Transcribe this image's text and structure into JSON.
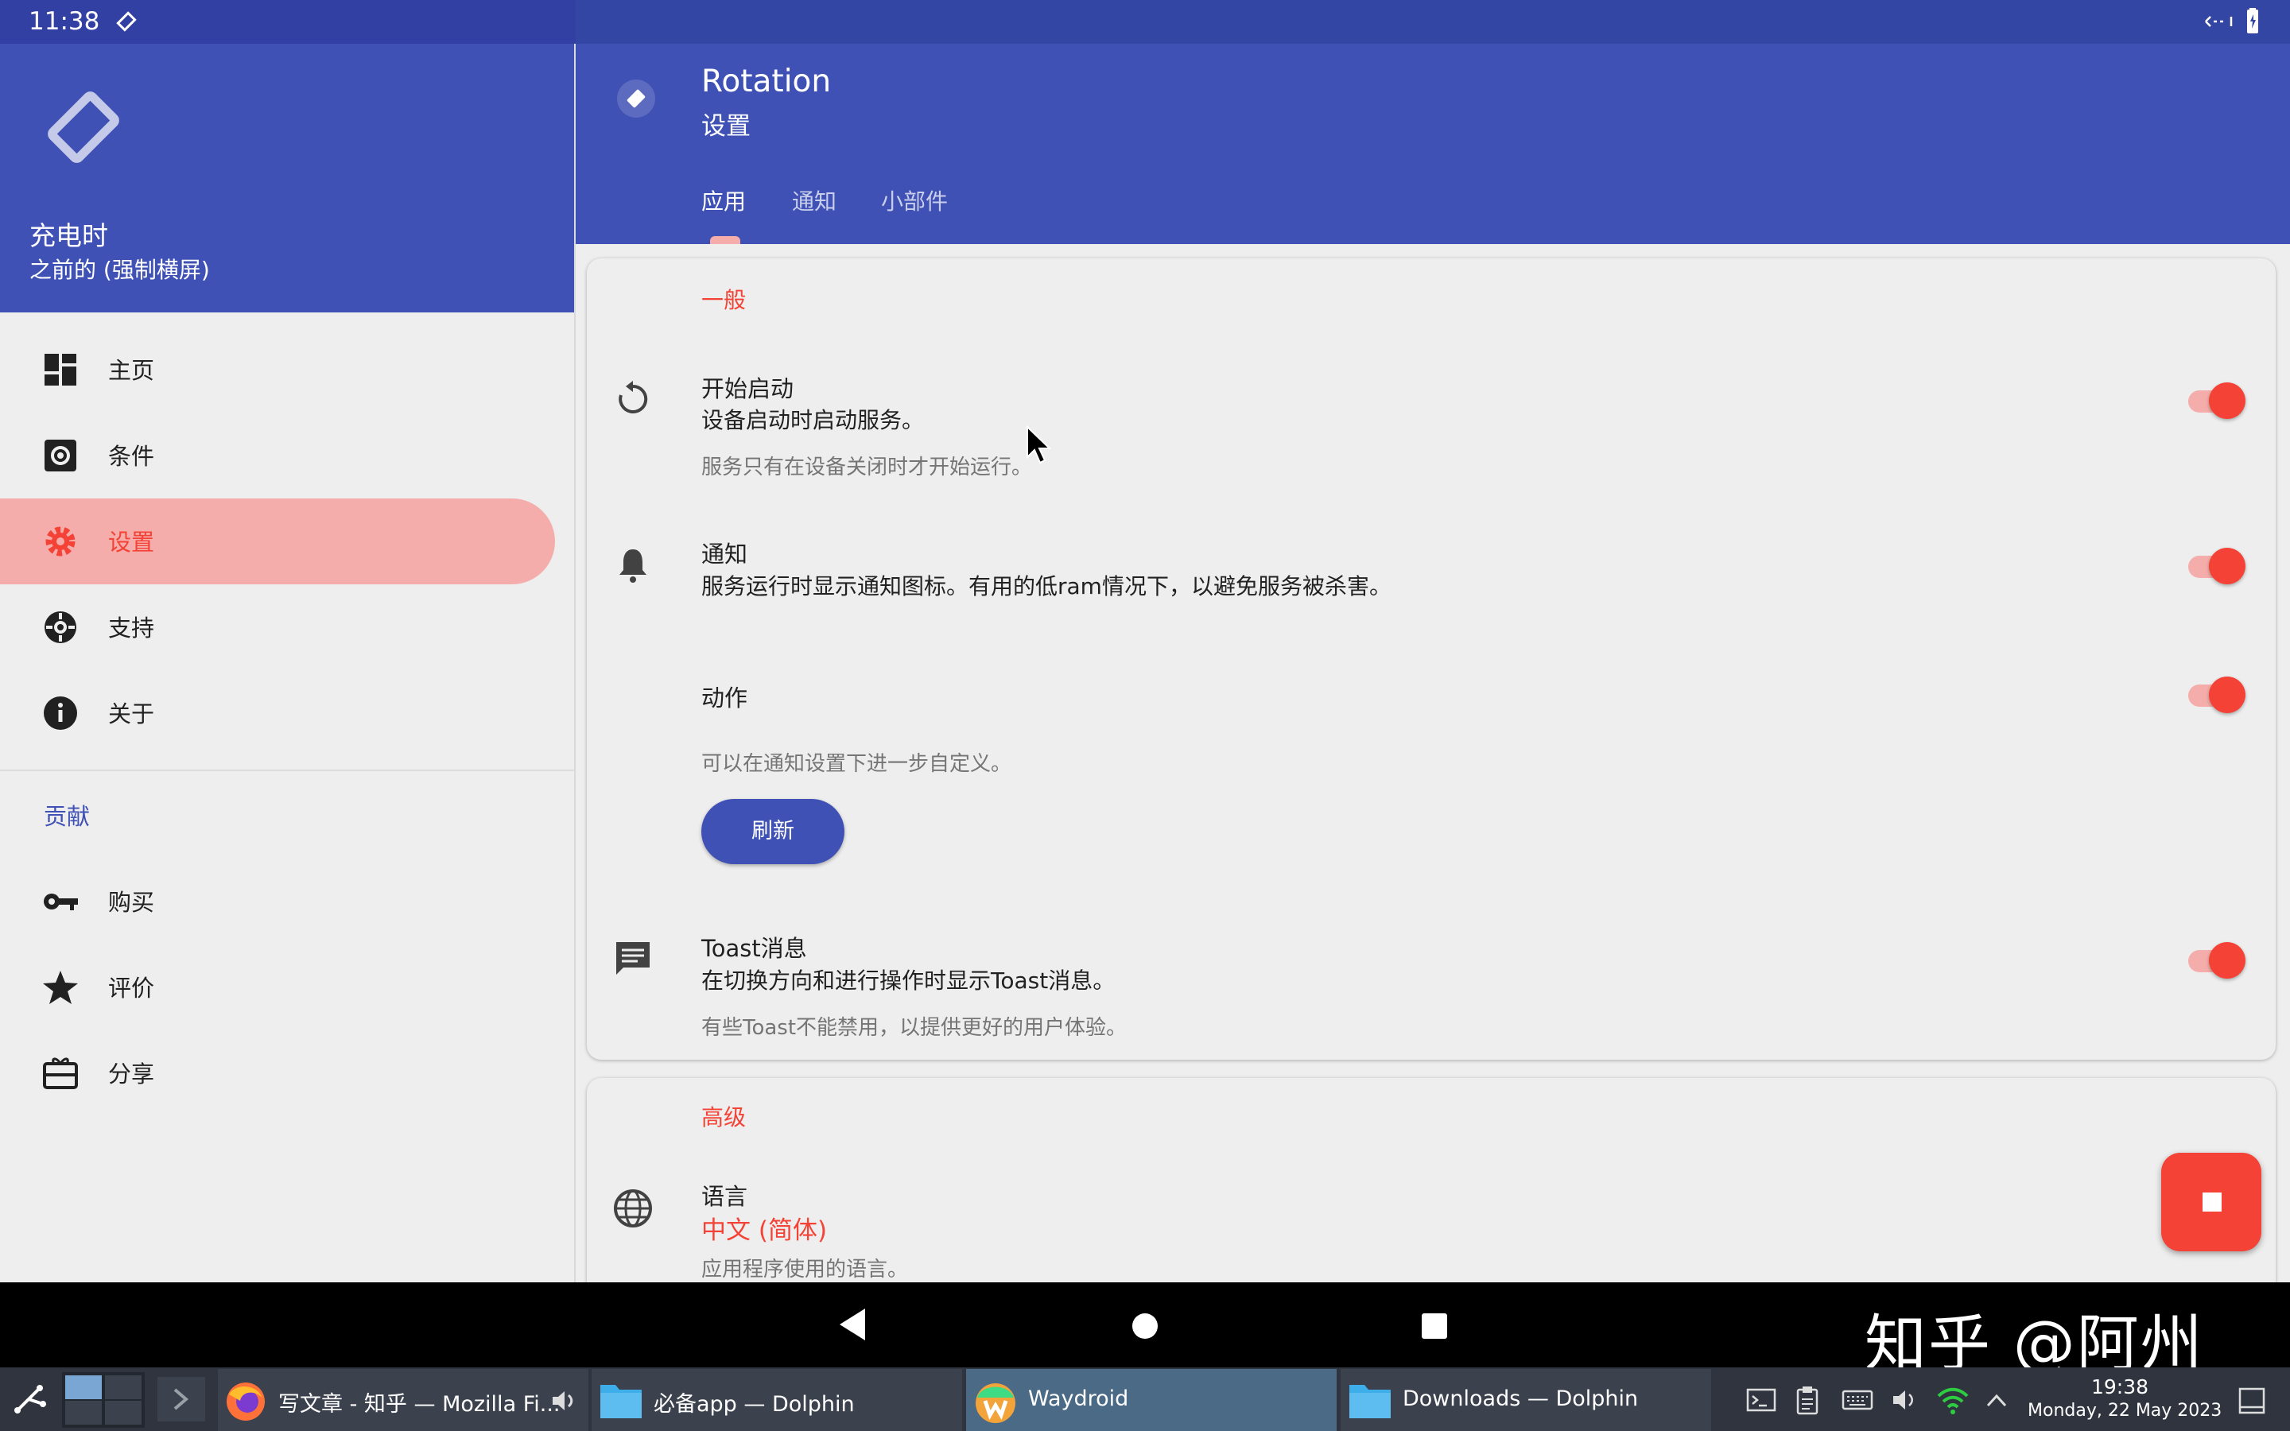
{
  "status_bar": {
    "time": "11:38"
  },
  "drawer": {
    "title": "充电时",
    "subtitle": "之前的 (强制横屏)",
    "items": [
      {
        "label": "主页",
        "icon": "dashboard-icon"
      },
      {
        "label": "条件",
        "icon": "conditions-icon"
      },
      {
        "label": "设置",
        "icon": "gear-icon",
        "active": true
      },
      {
        "label": "支持",
        "icon": "lifebuoy-icon"
      },
      {
        "label": "关于",
        "icon": "info-icon"
      }
    ],
    "section_label": "贡献",
    "section_items": [
      {
        "label": "购买",
        "icon": "key-icon"
      },
      {
        "label": "评价",
        "icon": "star-icon"
      },
      {
        "label": "分享",
        "icon": "gift-card-icon"
      }
    ]
  },
  "appbar": {
    "title": "Rotation",
    "subtitle": "设置",
    "tabs": [
      {
        "label": "应用",
        "active": true
      },
      {
        "label": "通知"
      },
      {
        "label": "小部件"
      }
    ]
  },
  "general": {
    "title": "一般",
    "start": {
      "title": "开始启动",
      "summary": "设备启动时启动服务。",
      "hint": "服务只有在设备关闭时才开始运行。",
      "enabled": true
    },
    "notification": {
      "title": "通知",
      "summary": "服务运行时显示通知图标。有用的低ram情况下，以避免服务被杀害。",
      "enabled": true
    },
    "actions": {
      "title": "动作",
      "hint": "可以在通知设置下进一步自定义。",
      "button": "刷新",
      "enabled": true
    },
    "toast": {
      "title": "Toast消息",
      "summary": "在切换方向和进行操作时显示Toast消息。",
      "hint": "有些Toast不能禁用，以提供更好的用户体验。",
      "enabled": true
    }
  },
  "advanced": {
    "title": "高级",
    "language": {
      "title": "语言",
      "value": "中文 (简体)",
      "hint": "应用程序使用的语言。"
    }
  },
  "watermark": "知乎 @阿州",
  "taskbar": {
    "tasks": [
      {
        "label": "写文章 - 知乎 — Mozilla Fi...",
        "icon": "firefox-icon"
      },
      {
        "label": "必备app — Dolphin",
        "icon": "folder-icon"
      },
      {
        "label": "Waydroid",
        "icon": "waydroid-icon",
        "active": true
      },
      {
        "label": "Downloads — Dolphin",
        "icon": "folder-icon"
      }
    ],
    "time": "19:38",
    "date": "Monday, 22 May 2023"
  },
  "colors": {
    "primary": "#3f51b5",
    "accent": "#f44336",
    "accent_light": "#f4adaa"
  }
}
